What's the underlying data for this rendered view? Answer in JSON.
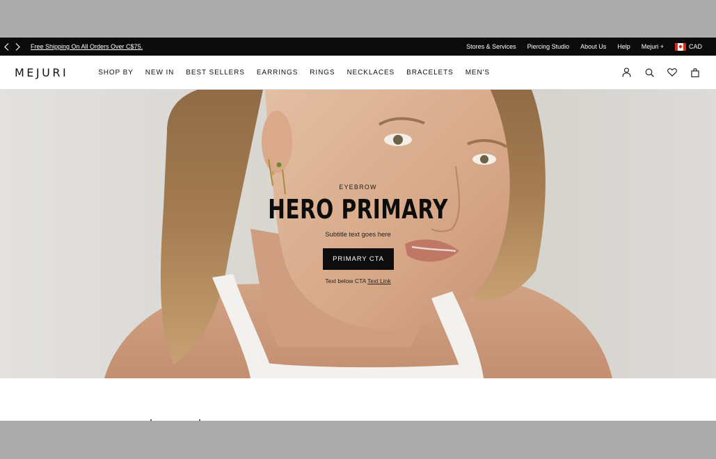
{
  "announcement": {
    "prev_label": "‹",
    "next_label": "›",
    "promo_text": "Free Shipping On All Orders Over C$75.",
    "links": [
      "Stores & Services",
      "Piercing Studio",
      "About Us",
      "Help",
      "Mejuri +"
    ],
    "currency": "CAD"
  },
  "header": {
    "logo": "MEJURI",
    "nav": [
      "SHOP BY",
      "NEW IN",
      "BEST SELLERS",
      "EARRINGS",
      "RINGS",
      "NECKLACES",
      "BRACELETS",
      "MEN'S"
    ],
    "icons": [
      "account-icon",
      "search-icon",
      "wishlist-heart-icon",
      "shopping-bag-icon"
    ]
  },
  "hero": {
    "eyebrow": "EYEBROW",
    "title": "HERO PRIMARY",
    "subtitle": "Subtitle text goes here",
    "cta_label": "PRIMARY CTA",
    "below_text": "Text below CTA",
    "below_link": "Text Link"
  },
  "colors": {
    "announcement_bg": "#0b0b0b",
    "cta_bg": "#0d0d0d",
    "page_bg": "#ffffff"
  }
}
